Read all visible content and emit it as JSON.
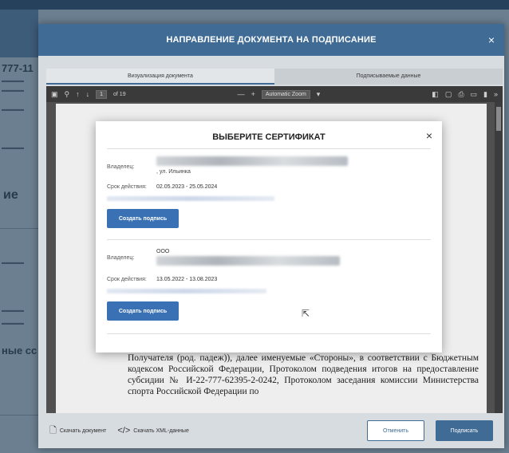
{
  "background": {
    "fragments": [
      "777-11",
      "ие",
      "ные сс"
    ]
  },
  "modal": {
    "title": "НАПРАВЛЕНИЕ ДОКУМЕНТА НА ПОДПИСАНИЕ",
    "close_icon": "×",
    "tabs": [
      {
        "label": "Визуализация документа",
        "active": true
      },
      {
        "label": "Подписываемые данные",
        "active": false
      }
    ],
    "pdf_toolbar": {
      "page_current": "1",
      "page_total": "of 19",
      "zoom": "Automatic Zoom"
    },
    "pdf_text": "Получателя (род. падеж)), далее именуемые «Стороны», в соответствии с Бюджетным кодексом Российской Федерации, Протоколом подведения итогов на предоставление субсидии № И-22-777-62395-2-0242, Протоколом заседания комиссии Министерства спорта Российской Федерации по",
    "footer": {
      "download_document": "Скачать документ",
      "download_xml": "Скачать XML-данные",
      "cancel": "Отменить",
      "sign": "Подписать"
    }
  },
  "cert_dialog": {
    "title": "ВЫБЕРИТЕ СЕРТИФИКАТ",
    "close_icon": "×",
    "items": [
      {
        "owner_label": "Владелец:",
        "owner_prefix": "",
        "address": ", ул. Ильинка",
        "validity_label": "Срок действия:",
        "validity": "02.05.2023 - 25.05.2024",
        "button": "Создать подпись"
      },
      {
        "owner_label": "Владелец:",
        "owner_prefix": "ООО",
        "address": "",
        "validity_label": "Срок действия:",
        "validity": "13.05.2022 - 13.08.2023",
        "button": "Создать подпись"
      }
    ]
  },
  "colors": {
    "header_blue": "#3f6b95",
    "button_blue": "#3a71b4"
  }
}
